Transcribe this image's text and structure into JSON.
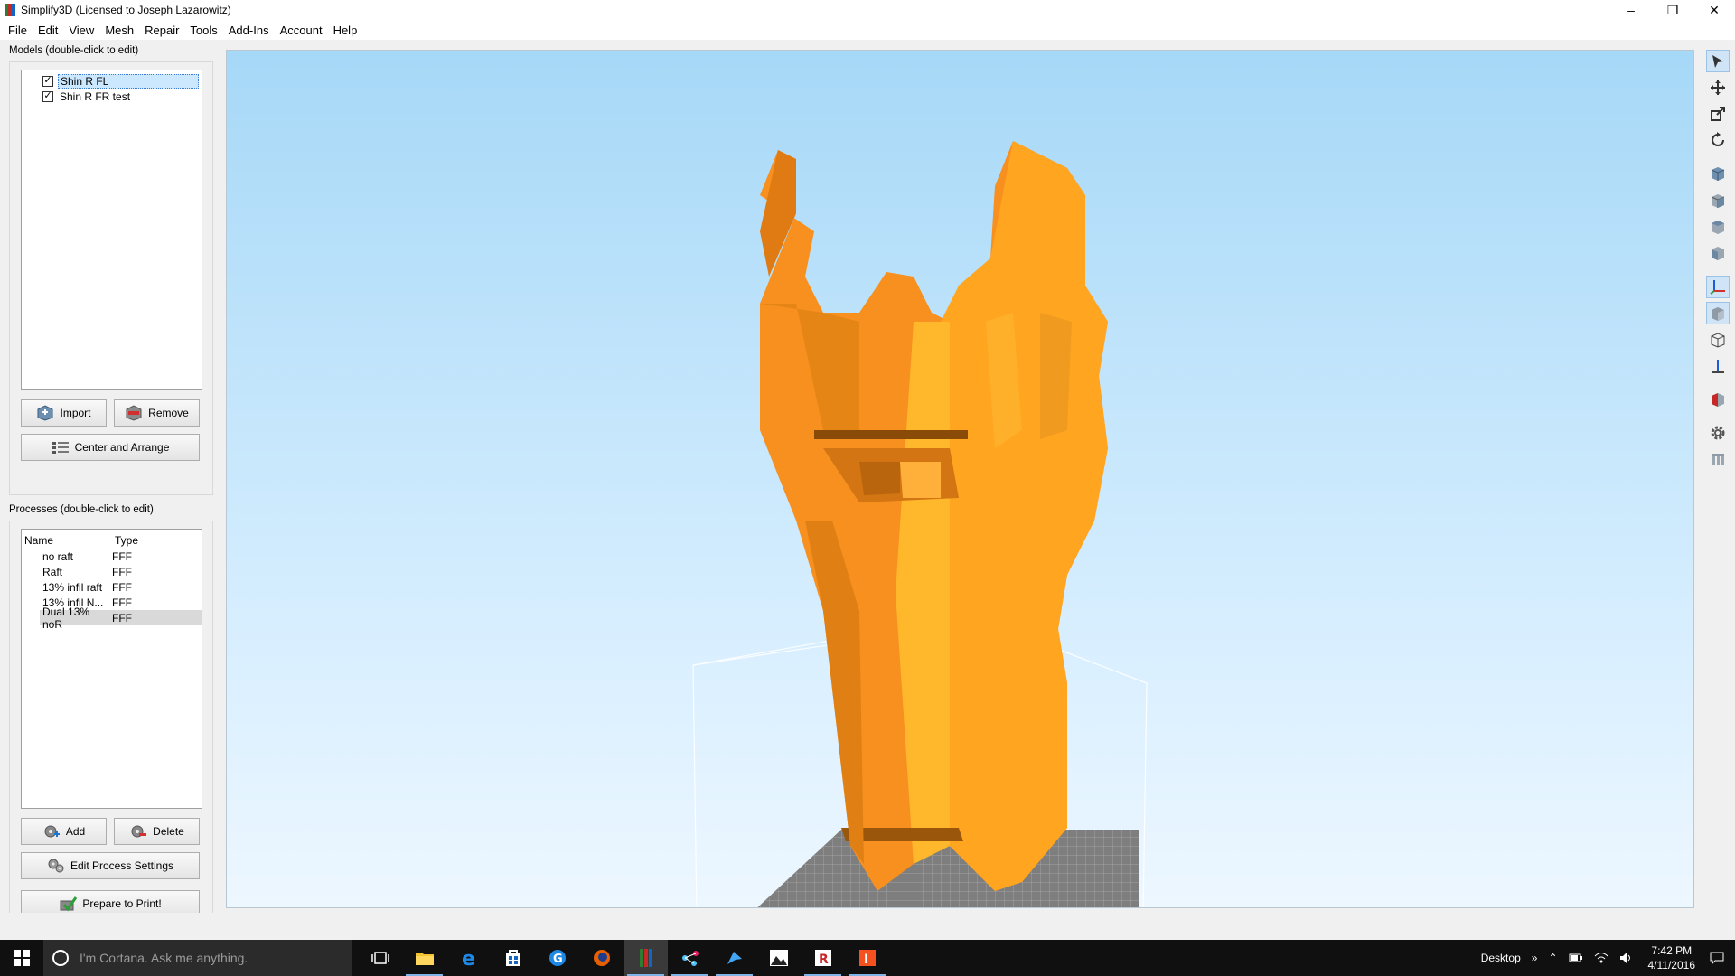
{
  "window": {
    "title": "Simplify3D (Licensed to Joseph Lazarowitz)",
    "controls": {
      "minimize": "–",
      "maximize": "❐",
      "close": "✕"
    }
  },
  "menu": [
    "File",
    "Edit",
    "View",
    "Mesh",
    "Repair",
    "Tools",
    "Add-Ins",
    "Account",
    "Help"
  ],
  "models": {
    "title": "Models (double-click to edit)",
    "items": [
      {
        "label": "Shin R FL",
        "checked": "✓"
      },
      {
        "label": "Shin R FR test",
        "checked": "✓"
      }
    ],
    "import_label": "Import",
    "remove_label": "Remove",
    "center_label": "Center and Arrange"
  },
  "processes": {
    "title": "Processes (double-click to edit)",
    "col_name": "Name",
    "col_type": "Type",
    "rows": [
      {
        "name": "no raft",
        "type": "FFF"
      },
      {
        "name": "Raft",
        "type": "FFF"
      },
      {
        "name": "13% infil raft",
        "type": "FFF"
      },
      {
        "name": "13% infil N...",
        "type": "FFF"
      },
      {
        "name": "Dual 13% noR",
        "type": "FFF"
      }
    ],
    "add_label": "Add",
    "delete_label": "Delete",
    "edit_label": "Edit Process Settings",
    "prepare_label": "Prepare to Print!"
  },
  "colors": {
    "model_orange": "#f7901e",
    "model_light": "#ffb428",
    "model_dark": "#d8700e",
    "bed": "#8c8c8c"
  },
  "taskbar": {
    "search_placeholder": "I'm Cortana. Ask me anything.",
    "desktop_label": "Desktop",
    "time": "7:42 PM",
    "date": "4/11/2016"
  }
}
